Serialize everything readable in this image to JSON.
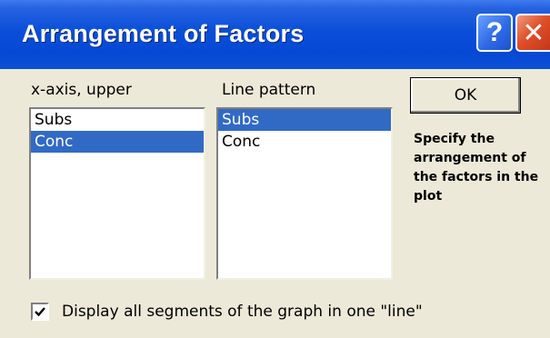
{
  "window": {
    "title": "Arrangement of Factors",
    "help_glyph": "?",
    "close_glyph": "✕",
    "titlebar_color": "#0a50d6",
    "client_color": "#ece9d8"
  },
  "x_axis": {
    "label": "x-axis, upper",
    "items": [
      {
        "label": "Subs",
        "selected": false
      },
      {
        "label": "Conc",
        "selected": true
      }
    ]
  },
  "line_pattern": {
    "label": "Line pattern",
    "items": [
      {
        "label": "Subs",
        "selected": true
      },
      {
        "label": "Conc",
        "selected": false
      }
    ]
  },
  "ok_button": {
    "label": "OK"
  },
  "help_text": "Specify the arrangement of the factors in the plot",
  "option": {
    "checked": true,
    "label": "Display all segments of the graph in one \"line\""
  },
  "selection_color": "#316ac5"
}
